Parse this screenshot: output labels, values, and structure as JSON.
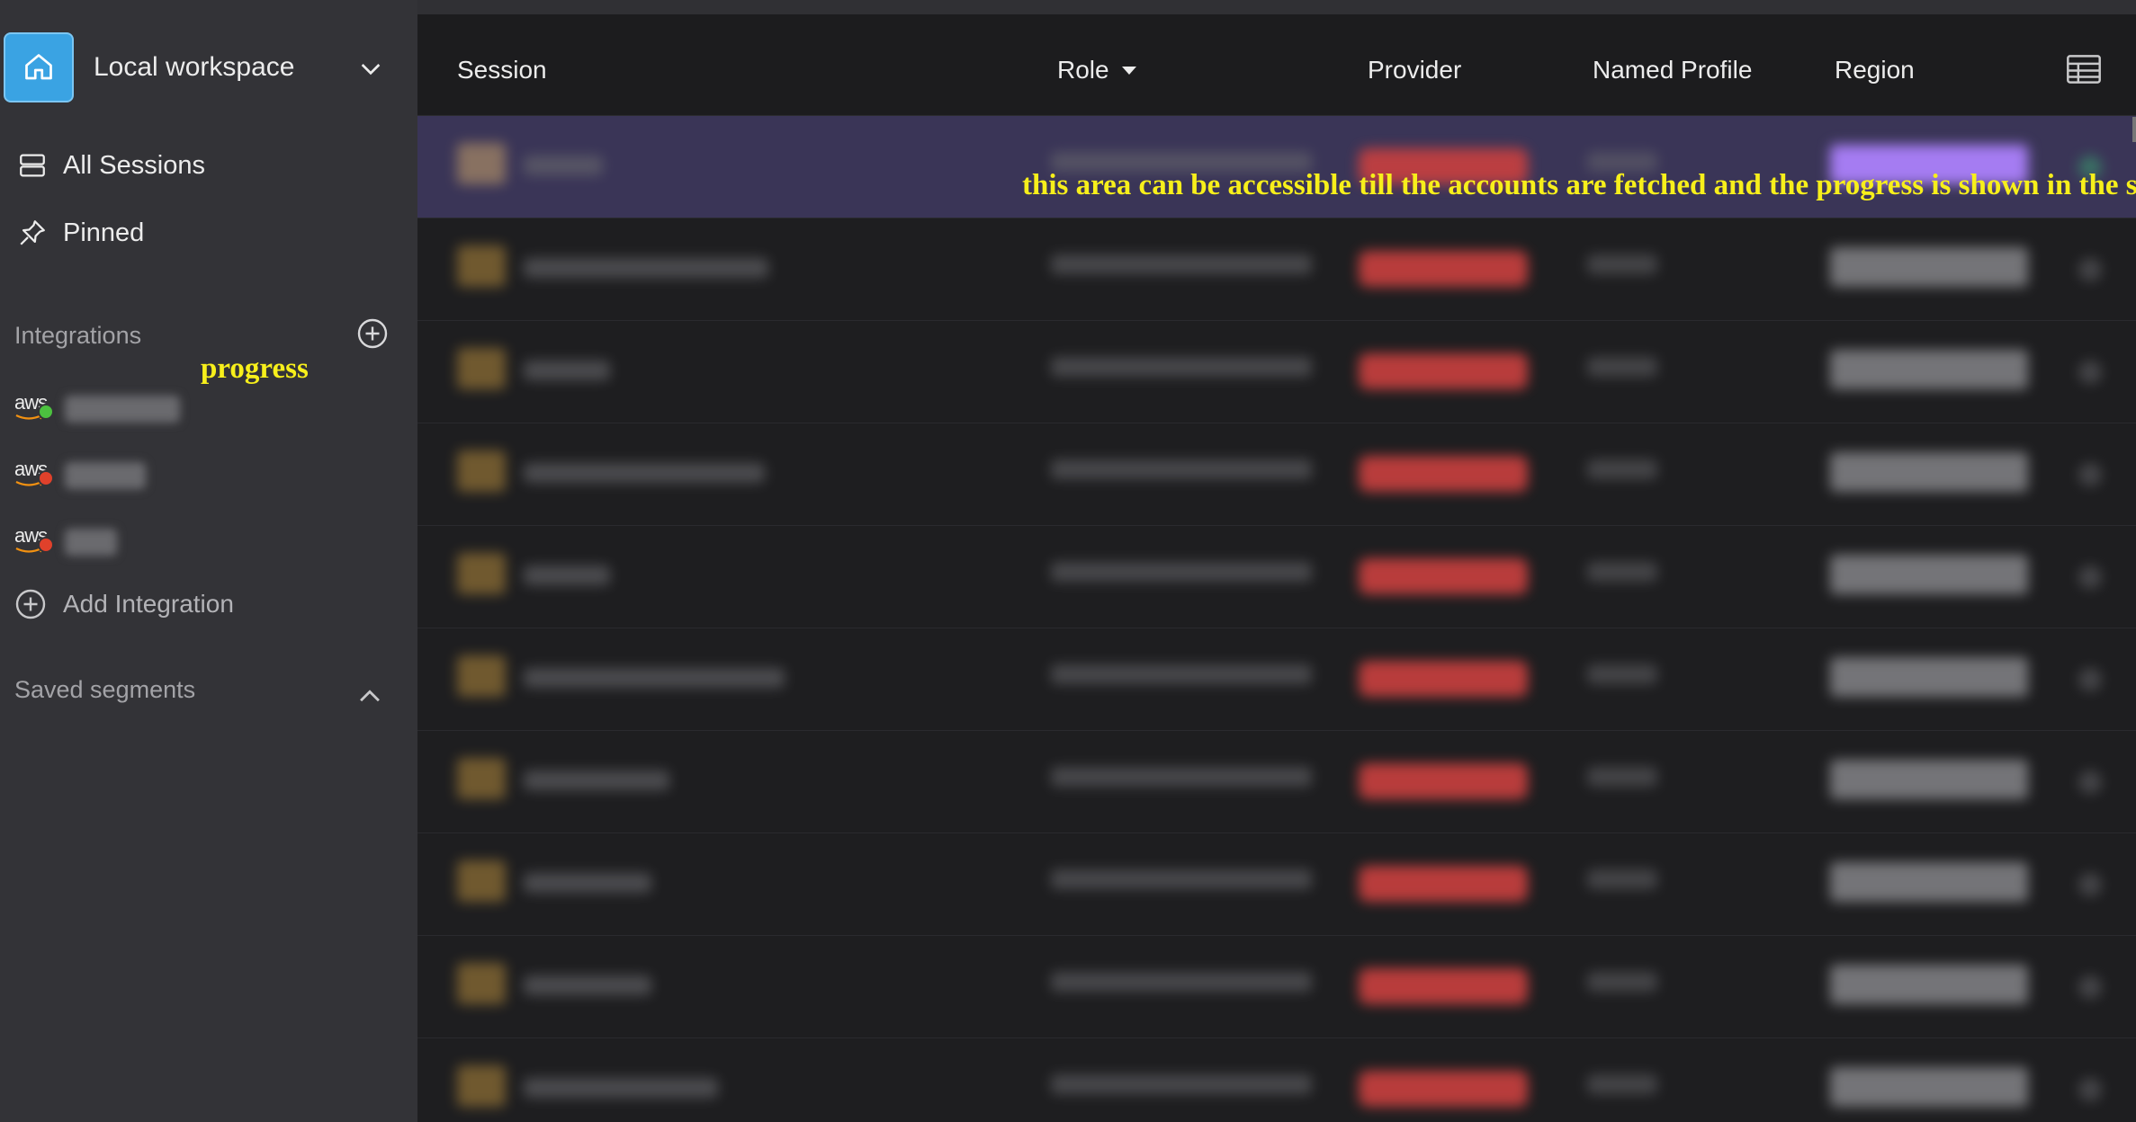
{
  "workspace": {
    "title": "Local workspace"
  },
  "nav": {
    "all_sessions": "All Sessions",
    "pinned": "Pinned"
  },
  "integrations": {
    "label": "Integrations",
    "items": [
      {
        "provider": "aws",
        "status": "green"
      },
      {
        "provider": "aws",
        "status": "red"
      },
      {
        "provider": "aws",
        "status": "red"
      }
    ],
    "add_label": "Add Integration"
  },
  "saved_segments": {
    "label": "Saved segments"
  },
  "annotations": {
    "sidebar": "progress",
    "main": "this area can be accessible till the accounts are fetched and the progress is shown in the sidebar"
  },
  "table": {
    "columns": {
      "session": "Session",
      "role": "Role",
      "provider": "Provider",
      "named_profile": "Named Profile",
      "region": "Region"
    },
    "row_count": 10
  },
  "colors": {
    "accent": "#3aa3e3",
    "annotation": "#f7ef1b",
    "status_green": "#4cc13f",
    "status_red": "#e0412b",
    "highlight_row": "#3a3557"
  }
}
